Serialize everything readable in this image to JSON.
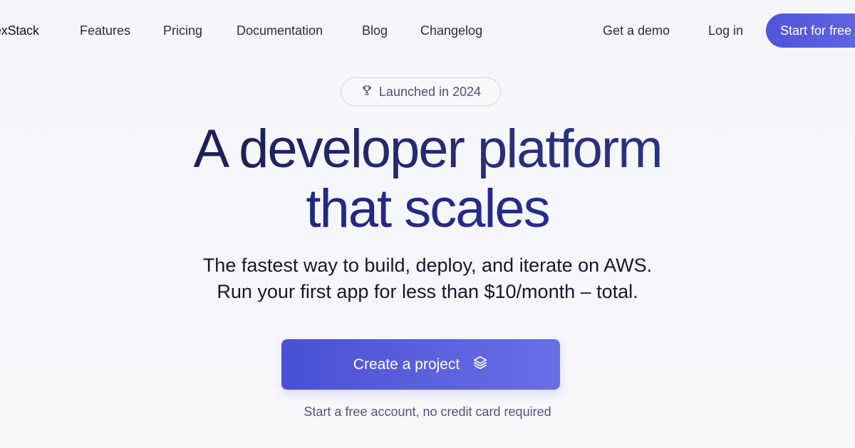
{
  "nav": {
    "brand": "exStack",
    "links": [
      "Features",
      "Pricing",
      "Documentation",
      "Blog",
      "Changelog"
    ],
    "demo": "Get a demo",
    "login": "Log in",
    "cta": "Start for free"
  },
  "hero": {
    "badge": "Launched in 2024",
    "badge_icon": "trophy-icon",
    "headline_line1": "A developer platform",
    "headline_line2": "that scales",
    "subhead_line1": "The fastest way to build, deploy, and iterate on AWS.",
    "subhead_line2": "Run your first app for less than $10/month – total.",
    "cta_label": "Create a project",
    "cta_icon": "layers-icon",
    "footnote": "Start a free account, no credit card required"
  },
  "colors": {
    "accent": "#5056d6",
    "headline_dark": "#15163a",
    "headline_blue": "#2b32a0"
  }
}
